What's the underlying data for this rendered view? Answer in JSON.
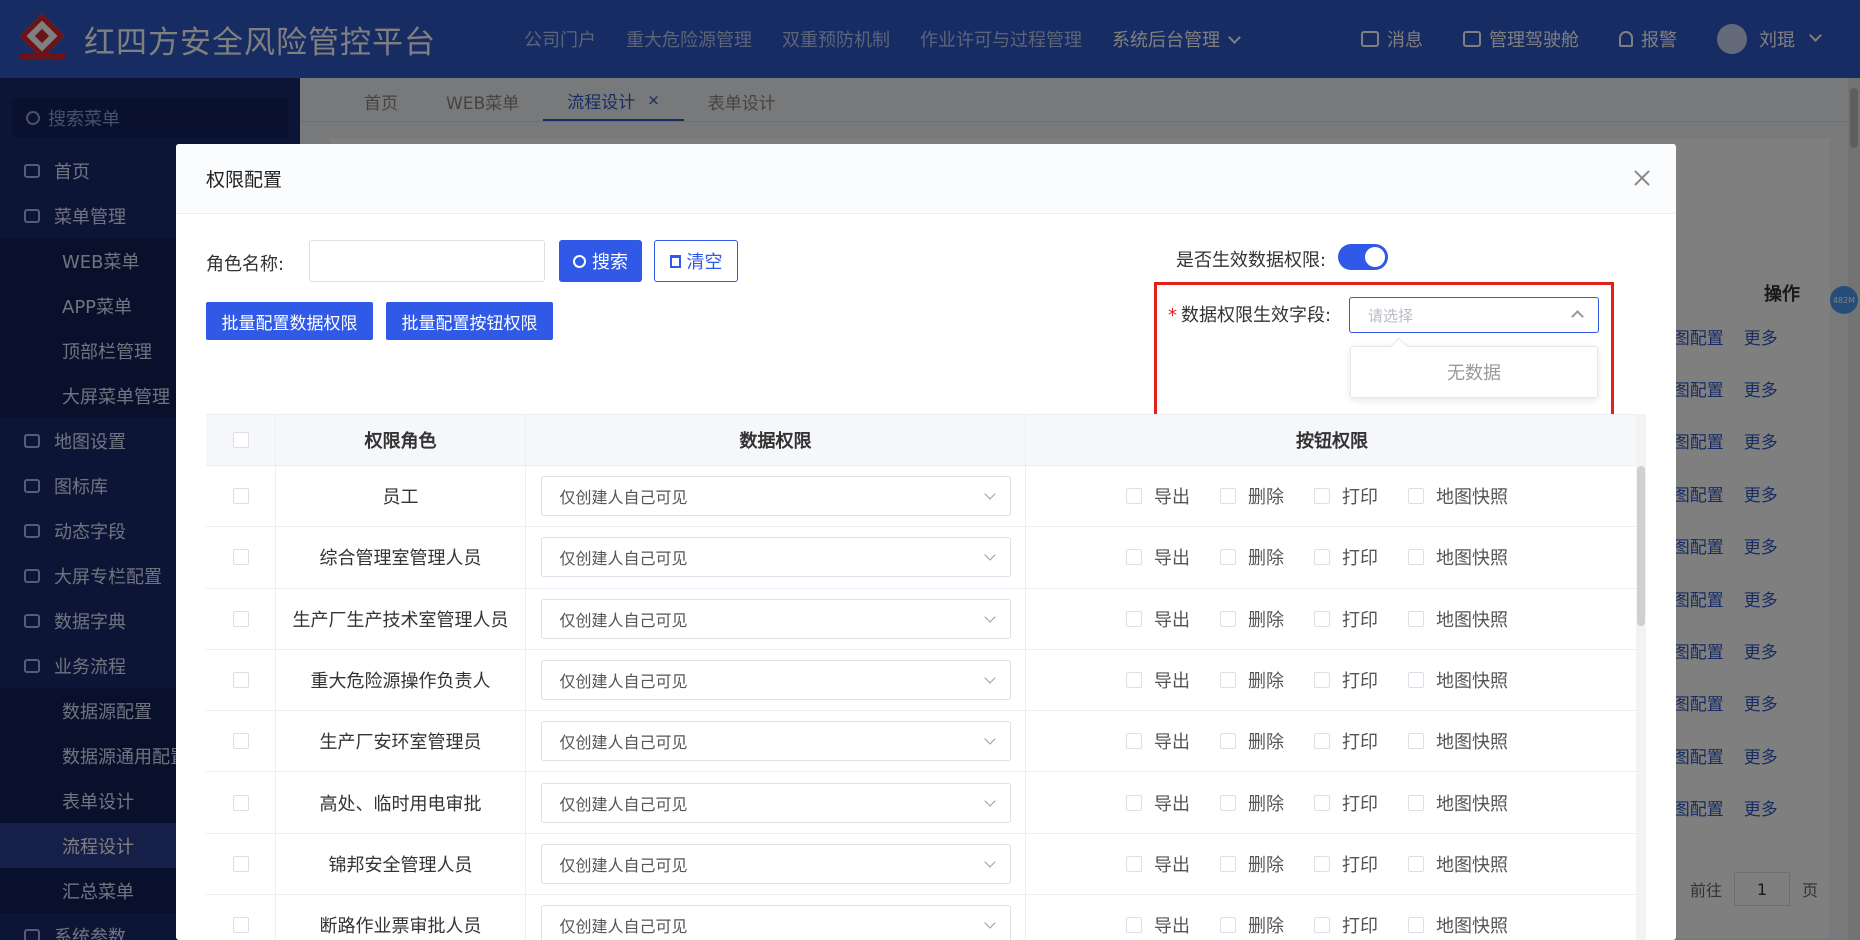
{
  "app": {
    "title": "红四方安全风险管控平台"
  },
  "topnav": {
    "items": [
      "公司门户",
      "重大危险源管理",
      "双重预防机制",
      "作业许可与过程管理",
      "系统后台管理"
    ],
    "right": {
      "messages": "消息",
      "cockpit": "管理驾驶舱",
      "alarm": "报警",
      "user": "刘琨"
    }
  },
  "sidebar": {
    "search_placeholder": "搜索菜单",
    "items": [
      "首页",
      "菜单管理",
      "WEB菜单",
      "APP菜单",
      "顶部栏管理",
      "大屏菜单管理",
      "地图设置",
      "图标库",
      "动态字段",
      "大屏专栏配置",
      "数据字典",
      "业务流程",
      "数据源配置",
      "数据源通用配置",
      "表单设计",
      "流程设计",
      "汇总菜单",
      "系统参数"
    ]
  },
  "tabs": [
    "首页",
    "WEB菜单",
    "流程设计",
    "表单设计"
  ],
  "background": {
    "ops_header": "操作",
    "row_link1": "权限配置",
    "row_link1_visible": "Ŋ图配置",
    "row_link2": "更多",
    "pager_prefix": "前往",
    "pager_value": "1",
    "pager_suffix": "页",
    "mem_badge": "482M"
  },
  "dialog": {
    "title": "权限配置",
    "role_name_label": "角色名称:",
    "search_button": "搜索",
    "clear_button": "清空",
    "batch_data_button": "批量配置数据权限",
    "batch_button_button": "批量配置按钮权限",
    "enable_label": "是否生效数据权限:",
    "field_label": "数据权限生效字段:",
    "field_required": "*",
    "field_placeholder": "请选择",
    "dropdown_empty": "无数据",
    "table": {
      "headers": [
        "权限角色",
        "数据权限",
        "按钮权限"
      ],
      "button_options": [
        "导出",
        "删除",
        "打印",
        "地图快照"
      ],
      "rows": [
        {
          "role": "员工",
          "data": "仅创建人自己可见"
        },
        {
          "role": "综合管理室管理人员",
          "data": "仅创建人自己可见"
        },
        {
          "role": "生产厂生产技术室管理人员",
          "data": "仅创建人自己可见"
        },
        {
          "role": "重大危险源操作负责人",
          "data": "仅创建人自己可见"
        },
        {
          "role": "生产厂安环室管理员",
          "data": "仅创建人自己可见"
        },
        {
          "role": "高处、临时用电审批",
          "data": "仅创建人自己可见"
        },
        {
          "role": "锦邦安全管理人员",
          "data": "仅创建人自己可见"
        },
        {
          "role": "断路作业票审批人员",
          "data": "仅创建人自己可见"
        }
      ]
    }
  }
}
